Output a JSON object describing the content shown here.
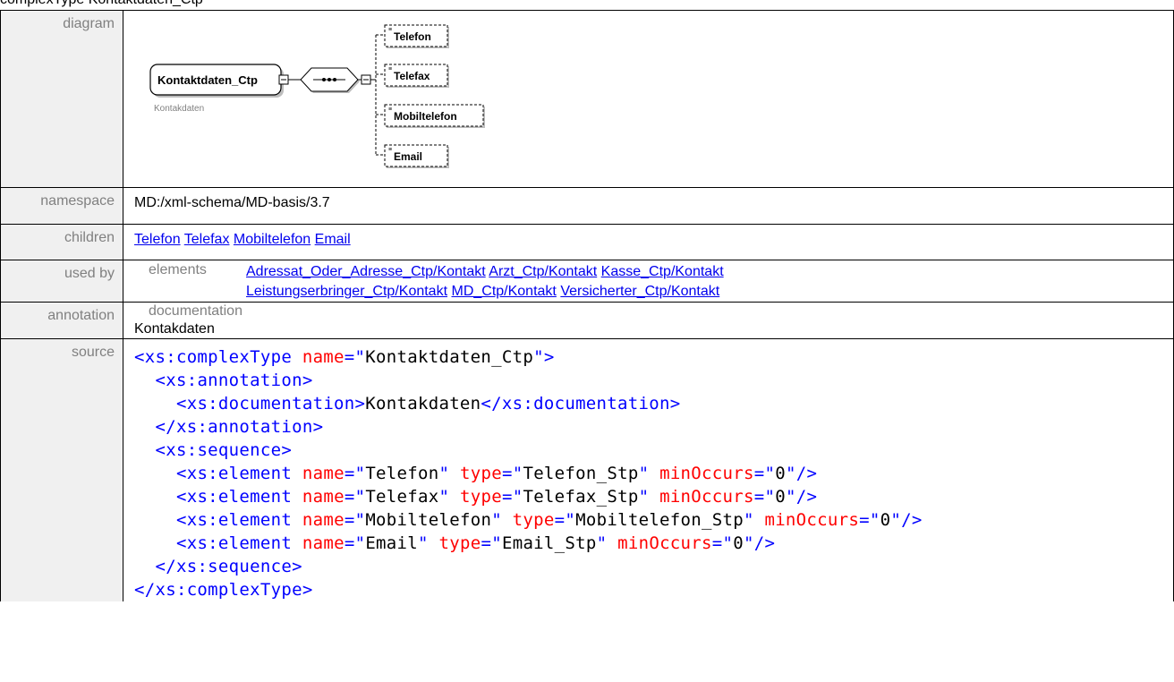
{
  "page": {
    "top_title": "complexType Kontaktdaten_Ctp"
  },
  "labels": {
    "diagram": "diagram",
    "namespace": "namespace",
    "children": "children",
    "used_by": "used by",
    "annotation": "annotation",
    "source": "source"
  },
  "diagram": {
    "root_name": "Kontaktdaten_Ctp",
    "root_caption": "Kontakdaten",
    "children": [
      "Telefon",
      "Telefax",
      "Mobiltelefon",
      "Email"
    ]
  },
  "namespace": "MD:/xml-schema/MD-basis/3.7",
  "children": [
    "Telefon",
    "Telefax",
    "Mobiltelefon",
    "Email"
  ],
  "used_by": {
    "kind": "elements",
    "links": [
      "Adressat_Oder_Adresse_Ctp/Kontakt",
      "Arzt_Ctp/Kontakt",
      "Kasse_Ctp/Kontakt",
      "Leistungserbringer_Ctp/Kontakt",
      "MD_Ctp/Kontakt",
      "Versicherter_Ctp/Kontakt"
    ]
  },
  "annotation": {
    "kind": "documentation",
    "text": "Kontakdaten"
  },
  "source_lines": [
    "<xs:complexType name=\"Kontaktdaten_Ctp\">",
    "  <xs:annotation>",
    "    <xs:documentation>Kontakdaten</xs:documentation>",
    "  </xs:annotation>",
    "  <xs:sequence>",
    "    <xs:element name=\"Telefon\" type=\"Telefon_Stp\" minOccurs=\"0\"/>",
    "    <xs:element name=\"Telefax\" type=\"Telefax_Stp\" minOccurs=\"0\"/>",
    "    <xs:element name=\"Mobiltelefon\" type=\"Mobiltelefon_Stp\" minOccurs=\"0\"/>",
    "    <xs:element name=\"Email\" type=\"Email_Stp\" minOccurs=\"0\"/>",
    "  </xs:sequence>",
    "</xs:complexType>"
  ],
  "colors": {
    "tag": "#0000ff",
    "attr": "#ff0000",
    "link": "#0000ee",
    "label_bg": "#f0f0f0",
    "label_text": "#808080"
  }
}
